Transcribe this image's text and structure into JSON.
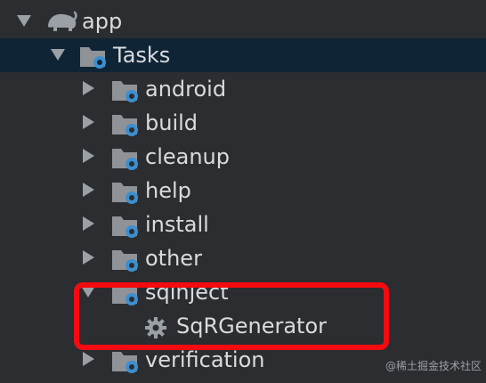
{
  "tree": {
    "app_label": "app",
    "tasks_label": "Tasks",
    "groups": [
      "android",
      "build",
      "cleanup",
      "help",
      "install",
      "other",
      "sqinject",
      "verification"
    ],
    "task_label": "SqRGenerator"
  },
  "watermark": "@稀土掘金技术社区",
  "colors": {
    "background": "#2b2d30",
    "selected_row": "#0f2536",
    "folder": "#8f9398",
    "gear": "#3d8fd0",
    "highlight": "#f40b10"
  }
}
